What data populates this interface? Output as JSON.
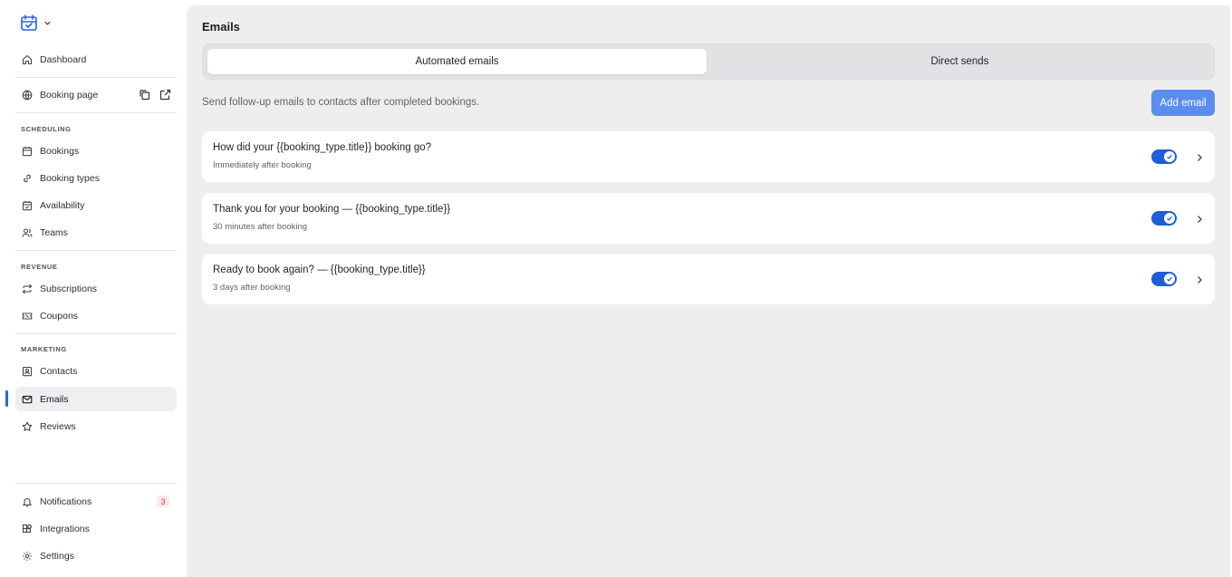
{
  "sidebar": {
    "top_items": [
      {
        "label": "Dashboard",
        "icon": "home-icon"
      },
      {
        "label": "Booking page",
        "icon": "globe-icon"
      }
    ],
    "sections": [
      {
        "label": "SCHEDULING",
        "items": [
          {
            "label": "Bookings",
            "icon": "calendar-icon"
          },
          {
            "label": "Booking types",
            "icon": "link-icon"
          },
          {
            "label": "Availability",
            "icon": "calendar-check-icon"
          },
          {
            "label": "Teams",
            "icon": "users-icon"
          }
        ]
      },
      {
        "label": "REVENUE",
        "items": [
          {
            "label": "Subscriptions",
            "icon": "repeat-icon"
          },
          {
            "label": "Coupons",
            "icon": "ticket-icon"
          }
        ]
      },
      {
        "label": "MARKETING",
        "items": [
          {
            "label": "Contacts",
            "icon": "contact-icon"
          },
          {
            "label": "Emails",
            "icon": "mail-icon"
          },
          {
            "label": "Reviews",
            "icon": "star-icon"
          }
        ]
      }
    ],
    "bottom_items": [
      {
        "label": "Notifications",
        "icon": "bell-icon",
        "badge": "3"
      },
      {
        "label": "Integrations",
        "icon": "puzzle-icon"
      },
      {
        "label": "Settings",
        "icon": "gear-icon"
      }
    ],
    "active_item": "Emails"
  },
  "main": {
    "title": "Emails",
    "tabs": [
      {
        "label": "Automated emails",
        "active": true
      },
      {
        "label": "Direct sends",
        "active": false
      }
    ],
    "subtitle": "Send follow-up emails to contacts after completed bookings.",
    "add_button": "Add email",
    "emails": [
      {
        "title": "How did your {{booking_type.title}} booking go?",
        "timing": "Immediately after booking",
        "enabled": true
      },
      {
        "title": "Thank you for your booking — {{booking_type.title}}",
        "timing": "30 minutes after booking",
        "enabled": true
      },
      {
        "title": "Ready to book again? — {{booking_type.title}}",
        "timing": "3 days after booking",
        "enabled": true
      }
    ]
  },
  "colors": {
    "accent": "#1d5fd6",
    "button": "#5b8def",
    "active_indicator": "#2563eb",
    "badge_text": "#d64040"
  }
}
